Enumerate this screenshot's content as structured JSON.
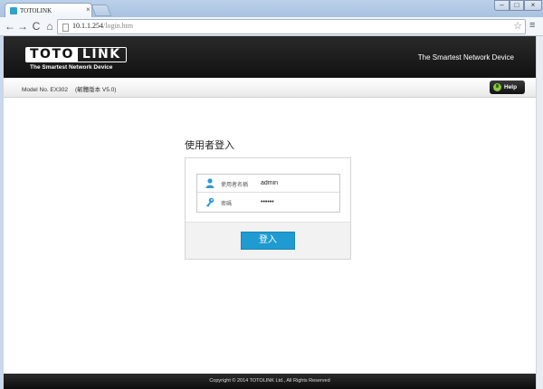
{
  "browser": {
    "tab_title": "TOTOLINK",
    "tab_close": "×",
    "url_host": "10.1.1.254",
    "url_path": "/login.htm",
    "window_controls": {
      "minimize": "–",
      "maximize": "□",
      "close": "×"
    },
    "nav_icons": {
      "back": "←",
      "forward": "→",
      "reload": "C",
      "home": "⌂"
    },
    "star": "☆",
    "menu": "≡"
  },
  "header": {
    "logo_part1": "TOTO",
    "logo_part2": "LINK",
    "logo_tagline": "The Smartest Network Device",
    "slogan": "The Smartest Network Device"
  },
  "subbar": {
    "model": "Model No. EX302",
    "firmware": "(韌體版本 V5.0)",
    "help_label": "Help"
  },
  "login": {
    "title": "使用者登入",
    "username_label": "使用者名稱",
    "username_value": "admin",
    "password_label": "密碼",
    "password_value": "••••••",
    "submit_label": "登入"
  },
  "footer": {
    "copyright": "Copyright © 2014 TOTOLINK Ltd.,   All Rights Reserved"
  },
  "colors": {
    "header_bg": "#111111",
    "accent": "#1f9bd1",
    "help_icon": "#8cc63f"
  }
}
